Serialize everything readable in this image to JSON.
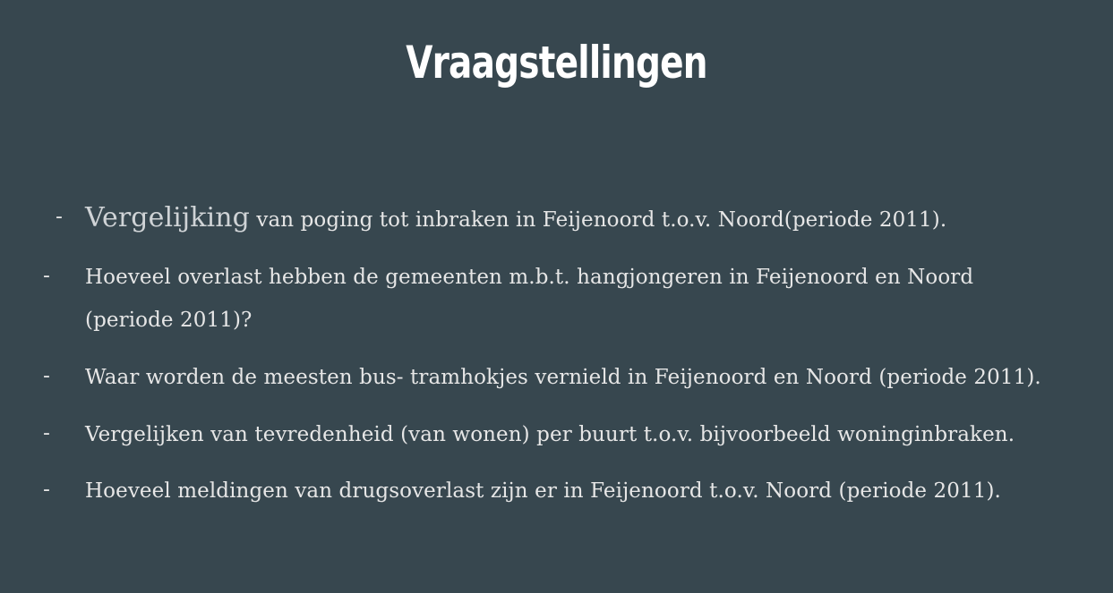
{
  "slide": {
    "title": "Vraagstellingen",
    "bullets": [
      {
        "dash": "-",
        "lead": "Vergelijking",
        "text": " van poging tot inbraken in Feijenoord t.o.v. Noord(periode 2011)."
      },
      {
        "dash": "-",
        "text": "Hoeveel overlast hebben de gemeenten m.b.t. hangjongeren in Feijenoord en Noord (periode 2011)?"
      },
      {
        "dash": "-",
        "text": "Waar worden de meesten bus- tramhokjes vernield in Feijenoord en Noord (periode 2011)."
      },
      {
        "dash": "-",
        "text": "Vergelijken van tevredenheid (van wonen) per buurt t.o.v. bijvoorbeeld woninginbraken."
      },
      {
        "dash": "-",
        "text": "Hoeveel meldingen van drugsoverlast zijn er in Feijenoord t.o.v. Noord (periode 2011)."
      }
    ]
  },
  "colors": {
    "background": "#37474f",
    "title": "#ffffff",
    "text": "#e6e6e6"
  }
}
